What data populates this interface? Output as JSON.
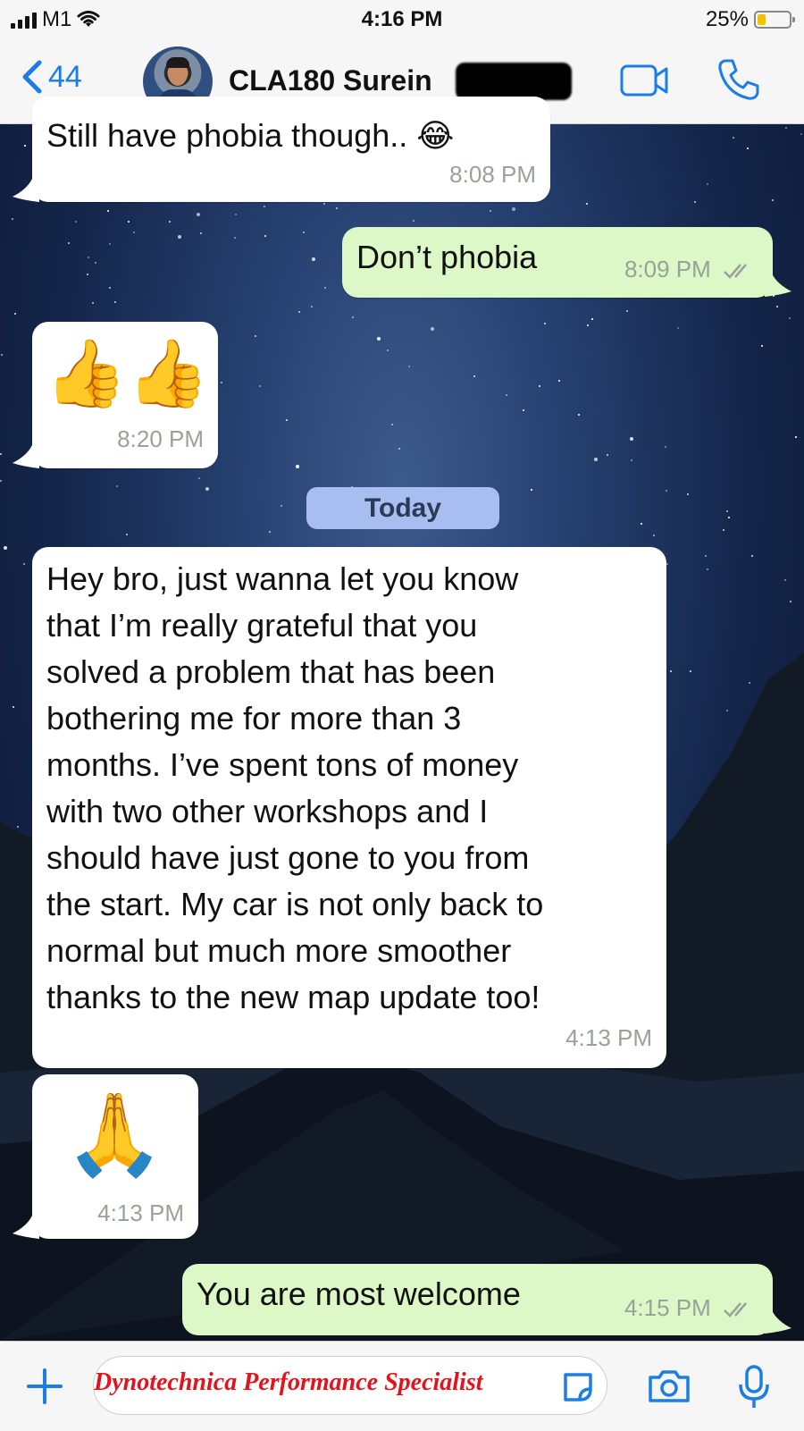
{
  "status_bar": {
    "carrier": "M1",
    "time": "4:16 PM",
    "battery_percent": "25%",
    "battery_level": 0.25
  },
  "header": {
    "back_count": "44",
    "contact_name": "CLA180 Surein",
    "icons": [
      "chevron-left-icon",
      "video-camera-icon",
      "phone-icon"
    ]
  },
  "messages": [
    {
      "direction": "incoming",
      "text": "Still have phobia though.. 😂",
      "time": "8:08 PM"
    },
    {
      "direction": "outgoing",
      "text": "Don’t phobia",
      "time": "8:09 PM",
      "status": "read"
    },
    {
      "direction": "incoming",
      "text": "👍👍",
      "time": "8:20 PM"
    },
    {
      "direction": "incoming",
      "text": "Hey bro, just wanna let you know that I’m really grateful that you solved a problem that has been bothering me for more than 3 months. I’ve spent tons of money with two other workshops and I should have just gone to you from the start. My car is not only back to normal but much more smoother thanks to the new map update too!",
      "time": "4:13 PM"
    },
    {
      "direction": "incoming",
      "text": "🙏",
      "time": "4:13 PM"
    },
    {
      "direction": "outgoing",
      "text": "You are most welcome",
      "time": "4:15 PM",
      "status": "read"
    }
  ],
  "date_separator": "Today",
  "long_message_lines": [
    "Hey bro, just wanna let you know",
    "that I’m really grateful that you",
    "solved a problem that has been",
    "bothering me for more than 3",
    "months. I’ve spent tons of money",
    "with two other workshops and I",
    "should have just gone to you from",
    "the start. My car is not only back to",
    "normal but much more smoother",
    "thanks to the new map update too!"
  ],
  "input_bar": {
    "watermark_text": "Dynotechnica Performance Specialist",
    "icons": [
      "plus-icon",
      "sticker-icon",
      "camera-icon",
      "microphone-icon"
    ]
  },
  "colors": {
    "accent": "#1a7ee6",
    "outgoing_bubble": "#dcf8c6",
    "incoming_bubble": "#ffffff",
    "date_pill": "#a8bdf0",
    "watermark": "#e3121b"
  }
}
